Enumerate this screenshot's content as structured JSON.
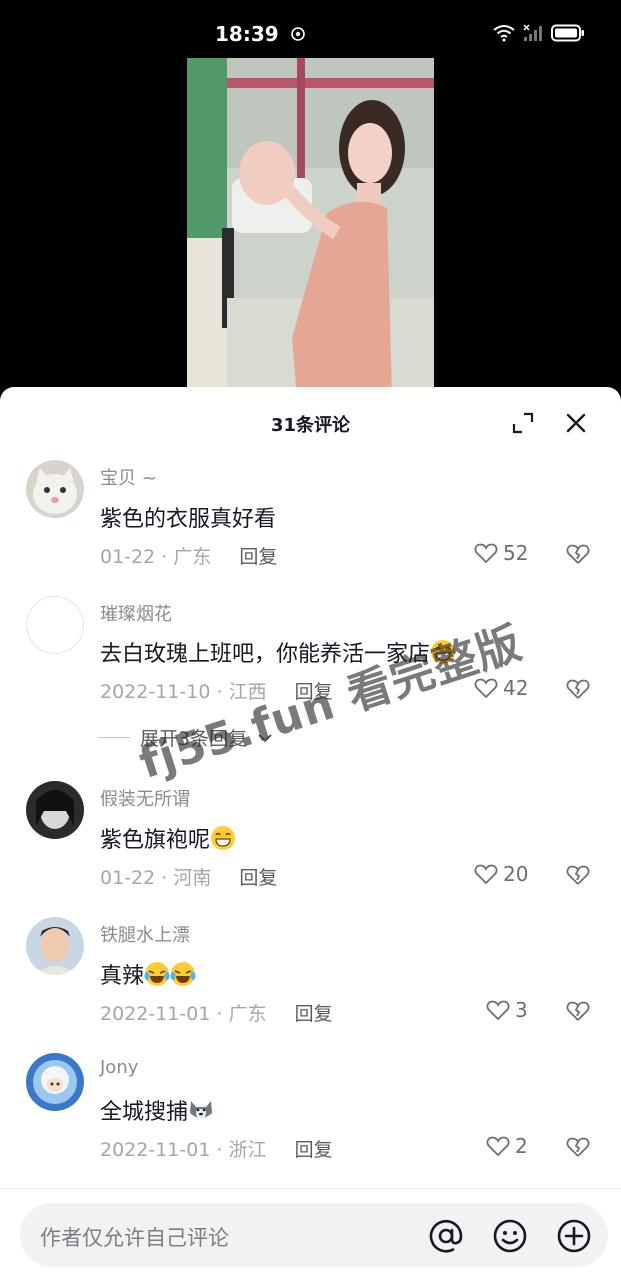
{
  "status_bar": {
    "time": "18:39"
  },
  "sheet": {
    "title": "31条评论"
  },
  "comments": [
    {
      "user": "宝贝 ~",
      "text": "紫色的衣服真好看",
      "date": "01-22",
      "location": "广东",
      "reply": "回复",
      "likes": "52"
    },
    {
      "user": "璀璨烟花",
      "text": "去白玫瑰上班吧，你能养活一家店",
      "date": "2022-11-10",
      "location": "江西",
      "reply": "回复",
      "likes": "42"
    },
    {
      "user": "假装无所谓",
      "text": "紫色旗袍呢",
      "date": "01-22",
      "location": "河南",
      "reply": "回复",
      "likes": "20"
    },
    {
      "user": "铁腿水上漂",
      "text": "真辣",
      "date": "2022-11-01",
      "location": "广东",
      "reply": "回复",
      "likes": "3"
    },
    {
      "user": "Jony",
      "text": "全城搜捕",
      "date": "2022-11-01",
      "location": "浙江",
      "reply": "回复",
      "likes": "2"
    }
  ],
  "expand_replies": {
    "label": "展开3条回复"
  },
  "watermark": {
    "text": "fj55.fun 看完整版"
  },
  "input": {
    "placeholder": "作者仅允许自己评论"
  },
  "separator": "·",
  "colors": {
    "sheet_bg": "#ffffff",
    "text_primary": "#161823",
    "text_secondary": "#8a8b91",
    "input_bg": "#f2f2f4"
  }
}
